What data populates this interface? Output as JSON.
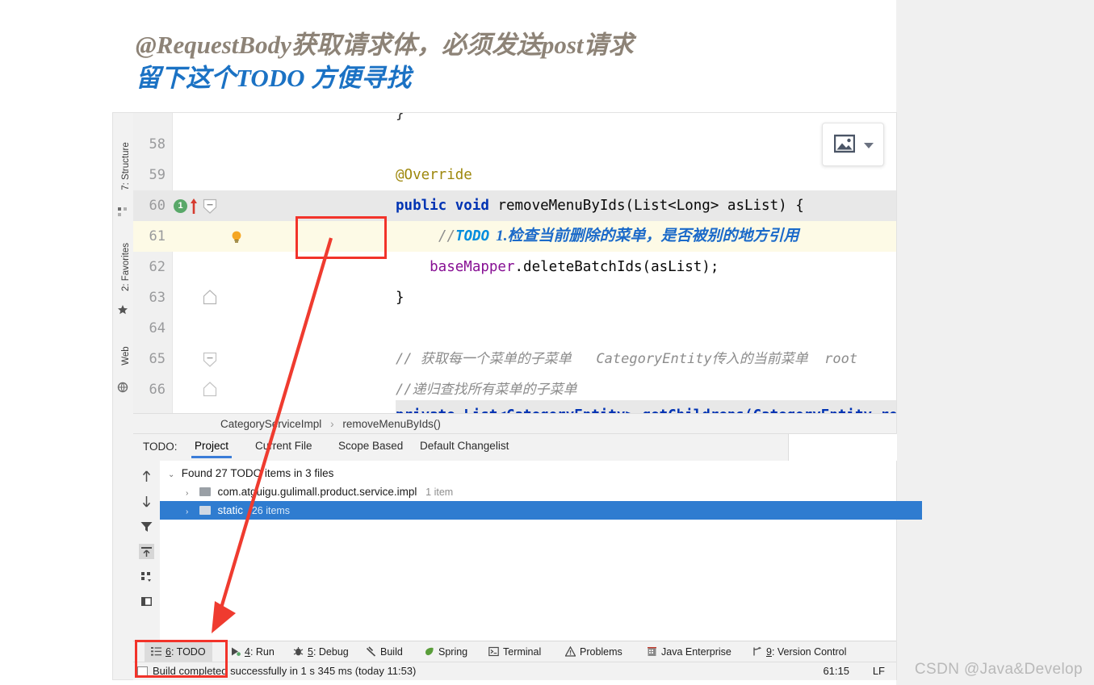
{
  "annotation": {
    "title_line1": "@RequestBody获取请求体，必须发送post请求",
    "title_line2": "留下这个TODO  方便寻找",
    "title_color_1": "#8d8377",
    "title_color_2": "#1b72c4",
    "highlight_color": "#f2332a"
  },
  "watermark": "CSDN @Java&Develop",
  "editor": {
    "lines": [
      {
        "num": "58",
        "segments": []
      },
      {
        "num": "59",
        "segments": [
          {
            "cls": "anno",
            "text": "@Override"
          }
        ]
      },
      {
        "num": "60",
        "segments": [
          {
            "cls": "kw",
            "text": "public void "
          },
          {
            "cls": "plain",
            "text": "removeMenuByIds(List<Long> asList) {"
          }
        ]
      },
      {
        "num": "61",
        "segments": []
      },
      {
        "num": "62",
        "segments": [
          {
            "cls": "fld",
            "text": "    baseMapper"
          },
          {
            "cls": "plain",
            "text": ".deleteBatchIds(asList);"
          }
        ]
      },
      {
        "num": "63",
        "segments": [
          {
            "cls": "plain",
            "text": "}"
          }
        ]
      },
      {
        "num": "64",
        "segments": []
      },
      {
        "num": "65",
        "segments": [
          {
            "cls": "cmt-it",
            "text": "// 获取每一个菜单的子菜单   CategoryEntity传入的当前菜单  root"
          }
        ]
      },
      {
        "num": "66",
        "segments": [
          {
            "cls": "cmt-it",
            "text": "//递归查找所有菜单的子菜单"
          }
        ]
      }
    ],
    "todo_line": {
      "num": "61",
      "slashes": "//",
      "keyword": "TODO",
      "text": "1.检查当前删除的菜单，是否被别的地方引用"
    },
    "line57_partial": "}",
    "line67_partial": "private List<CategoryEntity> getChildrens(CategoryEntity ro",
    "override_badge": "1"
  },
  "breadcrumb": {
    "items": [
      "CategoryServiceImpl",
      "removeMenuByIds()"
    ],
    "separator": "›"
  },
  "left_rail": {
    "items": [
      {
        "label": "7: Structure"
      },
      {
        "label": "2: Favorites"
      },
      {
        "label": "Web"
      }
    ]
  },
  "todo_window": {
    "prefix_label": "TODO:",
    "tabs": [
      {
        "label": "Project",
        "active": true
      },
      {
        "label": "Current File",
        "active": false
      },
      {
        "label": "Scope Based",
        "active": false
      },
      {
        "label": "Default Changelist",
        "active": false
      }
    ],
    "sidebar_icons": [
      "arrow-up-icon",
      "arrow-down-icon",
      "filter-icon",
      "export-icon",
      "group-by-icon",
      "preview-pane-icon"
    ],
    "tree": [
      {
        "level": 0,
        "chevron": "⌄",
        "has_folder": false,
        "label": "Found 27 TODO items in 3 files",
        "count": "",
        "selected": false
      },
      {
        "level": 1,
        "chevron": "›",
        "has_folder": true,
        "label": "com.atguigu.gulimall.product.service.impl",
        "count": "1 item",
        "selected": false
      },
      {
        "level": 1,
        "chevron": "›",
        "has_folder": true,
        "label": "static",
        "count": "26 items",
        "selected": true
      }
    ]
  },
  "tool_window_bar": {
    "items": [
      {
        "icon": "todo-list-icon",
        "num": "6",
        "label": ": TODO",
        "active": true
      },
      {
        "icon": "run-icon",
        "num": "4",
        "label": ": Run",
        "active": false
      },
      {
        "icon": "debug-icon",
        "num": "5",
        "label": ": Debug",
        "active": false
      },
      {
        "icon": "build-hammer-icon",
        "num": "",
        "label": "Build",
        "active": false
      },
      {
        "icon": "spring-leaf-icon",
        "num": "",
        "label": "Spring",
        "active": false
      },
      {
        "icon": "terminal-icon",
        "num": "",
        "label": "Terminal",
        "active": false
      },
      {
        "icon": "problems-warning-icon",
        "num": "",
        "label": "Problems",
        "active": false
      },
      {
        "icon": "java-enterprise-icon",
        "num": "",
        "label": "Java Enterprise",
        "active": false
      },
      {
        "icon": "version-control-branch-icon",
        "num": "9",
        "label": ": Version Control",
        "active": false
      }
    ]
  },
  "status_bar": {
    "message": "Build completed successfully in 1 s 345 ms (today 11:53)",
    "caret_position": "61:15",
    "line_separator": "LF"
  },
  "image_widget": {
    "icon": "image-icon",
    "dropdown": "chevron-down-icon"
  }
}
